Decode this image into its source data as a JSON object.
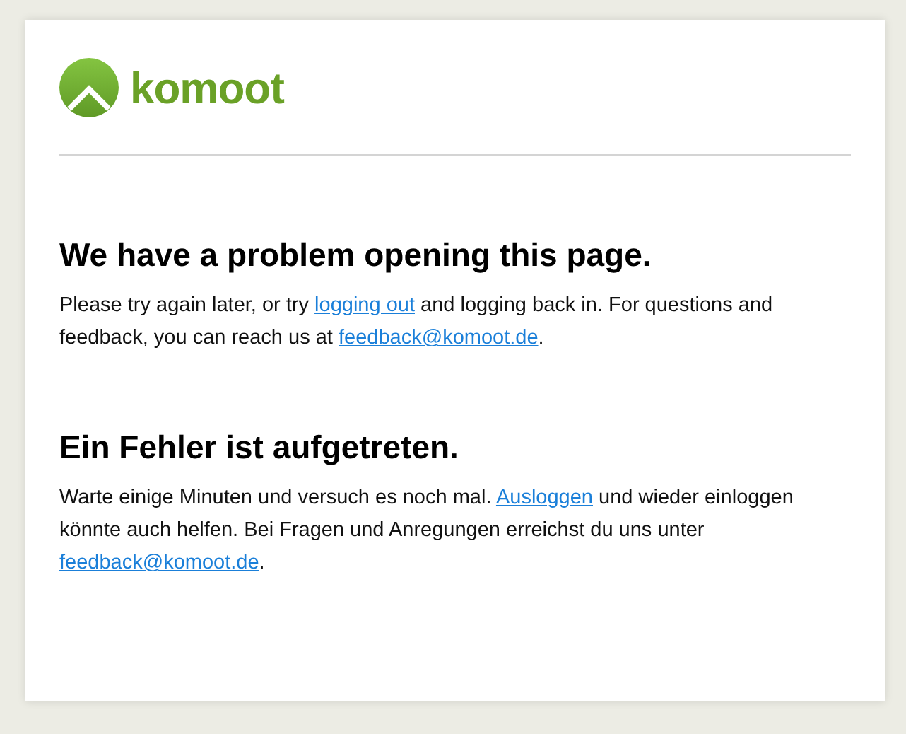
{
  "logo": {
    "text": "komoot"
  },
  "sections": [
    {
      "heading": "We have a problem opening this page.",
      "paragraph": [
        {
          "kind": "text",
          "text": "Please try again later, or try "
        },
        {
          "kind": "link",
          "text": "logging out"
        },
        {
          "kind": "text",
          "text": " and logging back in. For questions and feedback, you can reach us at "
        },
        {
          "kind": "link",
          "text": "feedback@komoot.de"
        },
        {
          "kind": "text",
          "text": "."
        }
      ]
    },
    {
      "heading": "Ein Fehler ist aufgetreten.",
      "paragraph": [
        {
          "kind": "text",
          "text": "Warte einige Minuten und versuch es noch mal. "
        },
        {
          "kind": "link",
          "text": "Ausloggen"
        },
        {
          "kind": "text",
          "text": " und wieder einloggen könnte auch helfen. Bei Fragen und Anregungen erreichst du uns unter "
        },
        {
          "kind": "link",
          "text": "feedback@komoot.de"
        },
        {
          "kind": "text",
          "text": "."
        }
      ]
    }
  ]
}
